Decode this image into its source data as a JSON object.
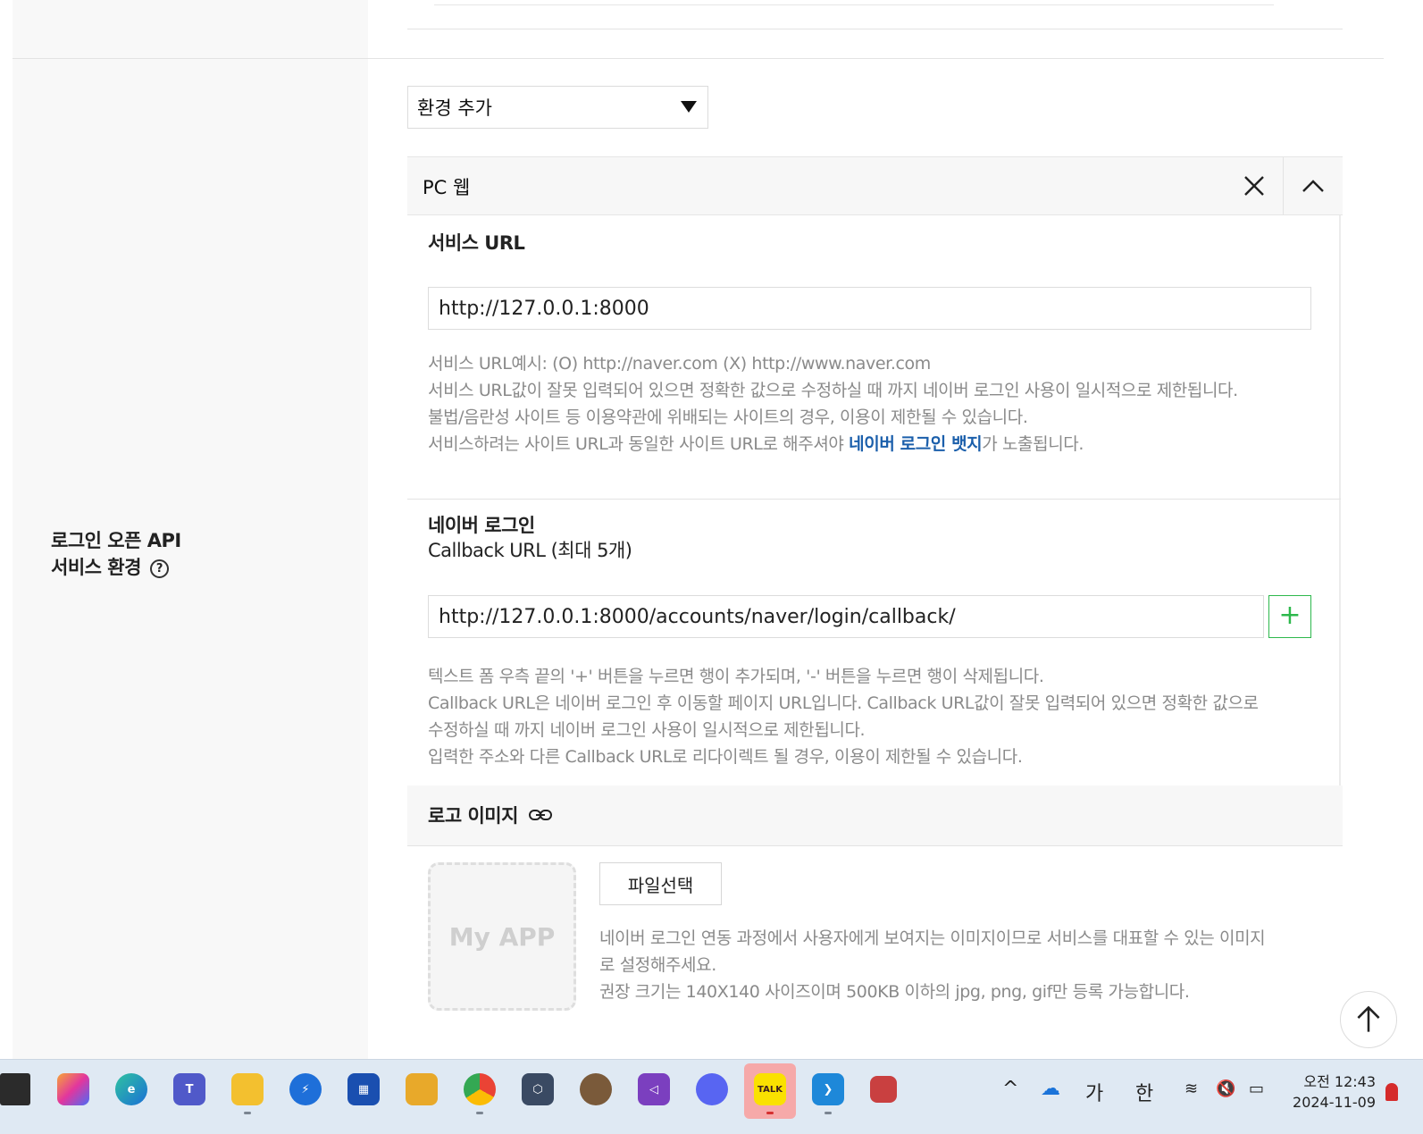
{
  "env_select": {
    "value": "환경 추가"
  },
  "panel": {
    "title": "PC 웹"
  },
  "service_url": {
    "title": "서비스 URL",
    "value": "http://127.0.0.1:8000",
    "help_line1": "서비스 URL예시: (O) http://naver.com (X) http://www.naver.com",
    "help_line2": "서비스 URL값이 잘못 입력되어 있으면 정확한 값으로 수정하실 때 까지 네이버 로그인 사용이 일시적으로 제한됩니다.",
    "help_line3": "불법/음란성 사이트 등 이용약관에 위배되는 사이트의 경우, 이용이 제한될 수 있습니다.",
    "help_line4_pre": "서비스하려는 사이트 URL과 동일한 사이트 URL로 해주셔야 ",
    "help_line4_link": "네이버 로그인 뱃지",
    "help_line4_post": "가 노출됩니다."
  },
  "callback": {
    "title_line1": "네이버 로그인",
    "title_line2": "Callback URL (최대 5개)",
    "value": "http://127.0.0.1:8000/accounts/naver/login/callback/",
    "plus_label": "+",
    "help_line1": "텍스트 폼 우측 끝의 '+' 버튼을 누르면 행이 추가되며, '-' 버튼을 누르면 행이 삭제됩니다.",
    "help_line2": "Callback URL은 네이버 로그인 후 이동할 페이지 URL입니다. Callback URL값이 잘못 입력되어 있으면 정확한 값으로",
    "help_line3": "수정하실 때 까지 네이버 로그인 사용이 일시적으로 제한됩니다.",
    "help_line4": "입력한 주소와 다른 Callback URL로 리다이렉트 될 경우, 이용이 제한될 수 있습니다."
  },
  "field_label": {
    "line1": "로그인 오픈 API",
    "line2": "서비스 환경",
    "help": "?"
  },
  "logo": {
    "title": "로고 이미지",
    "placeholder": "My APP",
    "file_button": "파일선택",
    "help_line1": "네이버 로그인 연동 과정에서 사용자에게 보여지는 이미지이므로 서비스를 대표할 수 있는 이미지",
    "help_line2": "로 설정해주세요.",
    "help_line3": "권장 크기는 140X140 사이즈이며 500KB 이하의 jpg, png, gif만 등록 가능합니다."
  },
  "taskbar": {
    "kakao_label": "TALK",
    "tray_lang1": "가",
    "tray_lang2": "한",
    "time": "12:43",
    "ampm": "오전",
    "date": "2024-11-09"
  },
  "colors": {
    "accent_green": "#2db84c",
    "link_blue": "#1b5fab",
    "help_gray": "#8a8a8a"
  }
}
